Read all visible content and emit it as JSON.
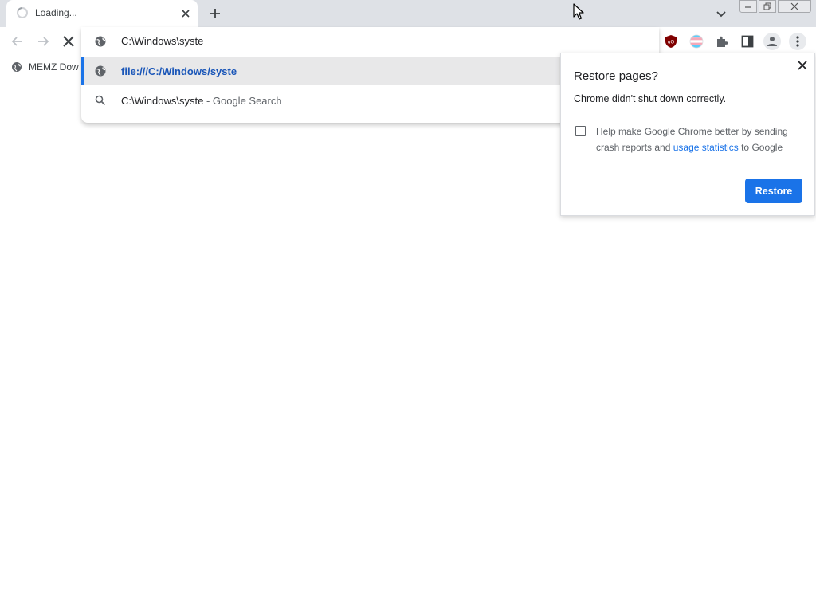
{
  "tab": {
    "title": "Loading...",
    "close_icon": "close-icon",
    "spinner_icon": "loading-spinner-icon"
  },
  "new_tab_icon": "plus-icon",
  "tab_search_icon": "chevron-down-icon",
  "window_controls": [
    "minimize-icon",
    "restore-icon",
    "close-icon"
  ],
  "toolbar": {
    "back_icon": "arrow-left-icon",
    "forward_icon": "arrow-right-icon",
    "stop_icon": "stop-x-icon",
    "extensions": [
      "ublock-origin-icon",
      "trans-flag-icon",
      "puzzle-icon"
    ],
    "side_panel_icon": "side-panel-icon",
    "profile_icon": "person-icon",
    "menu_icon": "kebab-menu-icon"
  },
  "bookmarks": {
    "items": [
      {
        "label": "MEMZ Dow",
        "icon": "globe-icon"
      }
    ]
  },
  "omnibox": {
    "input_value": "C:\\Windows\\syste",
    "suggestions": [
      {
        "text": "file:///C:/Windows/syste",
        "icon": "globe-icon",
        "selected": true
      },
      {
        "text": "C:\\Windows\\syste",
        "suffix": "- Google Search",
        "icon": "search-icon",
        "selected": false
      }
    ]
  },
  "restore_bubble": {
    "title": "Restore pages?",
    "message": "Chrome didn't shut down correctly.",
    "checkbox_checked": false,
    "checkbox_label_before": "Help make Google Chrome better by sending crash reports and ",
    "checkbox_link": "usage statistics",
    "checkbox_label_after": " to Google",
    "restore_label": "Restore"
  },
  "colors": {
    "accent": "#1a73e8",
    "tabstrip": "#dee1e6",
    "selected_row": "#e8e8e9"
  }
}
